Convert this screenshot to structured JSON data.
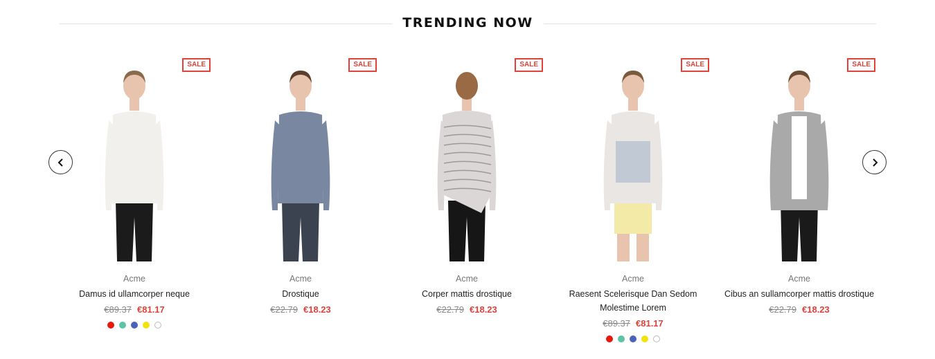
{
  "section": {
    "title": "TRENDING NOW"
  },
  "navigation": {
    "prev_icon": "chevron-left-icon",
    "next_icon": "chevron-right-icon"
  },
  "colors": {
    "accent": "#e0433a",
    "old_price": "#8a8a8a"
  },
  "products": [
    {
      "badge": "SALE",
      "vendor": "Acme",
      "title": "Damus id ullamcorper neque",
      "price_old": "€89.37",
      "price_new": "€81.17",
      "swatches": [
        "#e8170f",
        "#5cc4a5",
        "#4a63b9",
        "#f2e20e",
        "#ffffff"
      ],
      "top": "#f2f0ec",
      "bottom": "#1b1b1b",
      "hair": "#8a6a4c"
    },
    {
      "badge": "SALE",
      "vendor": "Acme",
      "title": "Drostique",
      "price_old": "€22.79",
      "price_new": "€18.23",
      "swatches": [],
      "top": "#7987a0",
      "bottom": "#3c4350",
      "hair": "#5a3e2b"
    },
    {
      "badge": "SALE",
      "vendor": "Acme",
      "title": "Corper mattis drostique",
      "price_old": "€22.79",
      "price_new": "€18.23",
      "swatches": [],
      "top": "#dad7d6",
      "bottom": "#161616",
      "hair": "#9a6a44"
    },
    {
      "badge": "SALE",
      "vendor": "Acme",
      "title": "Raesent Scelerisque Dan Sedom Molestime Lorem",
      "price_old": "€89.37",
      "price_new": "€81.17",
      "swatches": [
        "#e8170f",
        "#5cc4a5",
        "#4a63b9",
        "#f2e20e",
        "#ffffff"
      ],
      "top": "#e9e6e4",
      "bottom": "#f3eaa8",
      "hair": "#7a5a3c"
    },
    {
      "badge": "SALE",
      "vendor": "Acme",
      "title": "Cibus an sullamcorper mattis drostique",
      "price_old": "€22.79",
      "price_new": "€18.23",
      "swatches": [],
      "top": "#a9a9a9",
      "bottom": "#1a1a1a",
      "hair": "#6a4c34"
    }
  ]
}
